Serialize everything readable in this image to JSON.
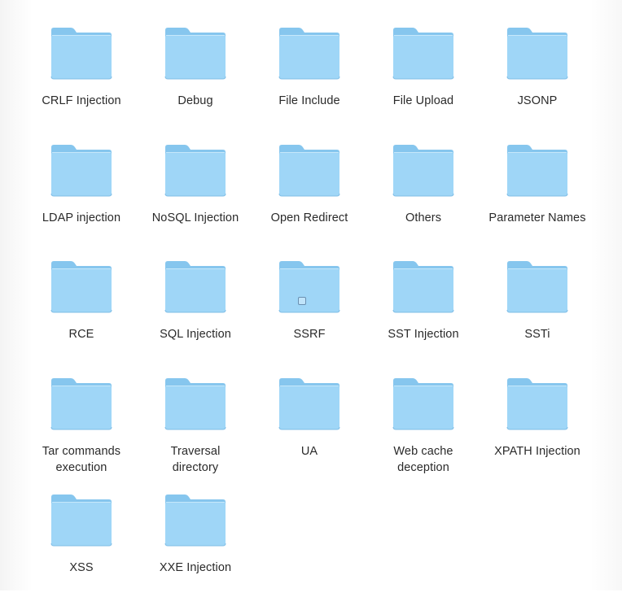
{
  "folders": [
    {
      "label": "CRLF Injection"
    },
    {
      "label": "Debug"
    },
    {
      "label": "File Include"
    },
    {
      "label": "File Upload"
    },
    {
      "label": "JSONP"
    },
    {
      "label": "LDAP injection"
    },
    {
      "label": "NoSQL Injection"
    },
    {
      "label": "Open Redirect"
    },
    {
      "label": "Others"
    },
    {
      "label": "Parameter Names"
    },
    {
      "label": "RCE"
    },
    {
      "label": "SQL Injection"
    },
    {
      "label": "SSRF"
    },
    {
      "label": "SST Injection"
    },
    {
      "label": "SSTi"
    },
    {
      "label": "Tar commands\nexecution"
    },
    {
      "label": "Traversal\ndirectory"
    },
    {
      "label": "UA"
    },
    {
      "label": "Web cache\ndeception"
    },
    {
      "label": "XPATH Injection"
    },
    {
      "label": "XSS"
    },
    {
      "label": "XXE Injection"
    }
  ],
  "colors": {
    "folder_back": "#86c6ee",
    "folder_front": "#9fd6f7",
    "folder_edge": "#7fbde6"
  },
  "icons": {
    "folder": "folder-icon",
    "pointer": "mouse-pointer-icon"
  }
}
